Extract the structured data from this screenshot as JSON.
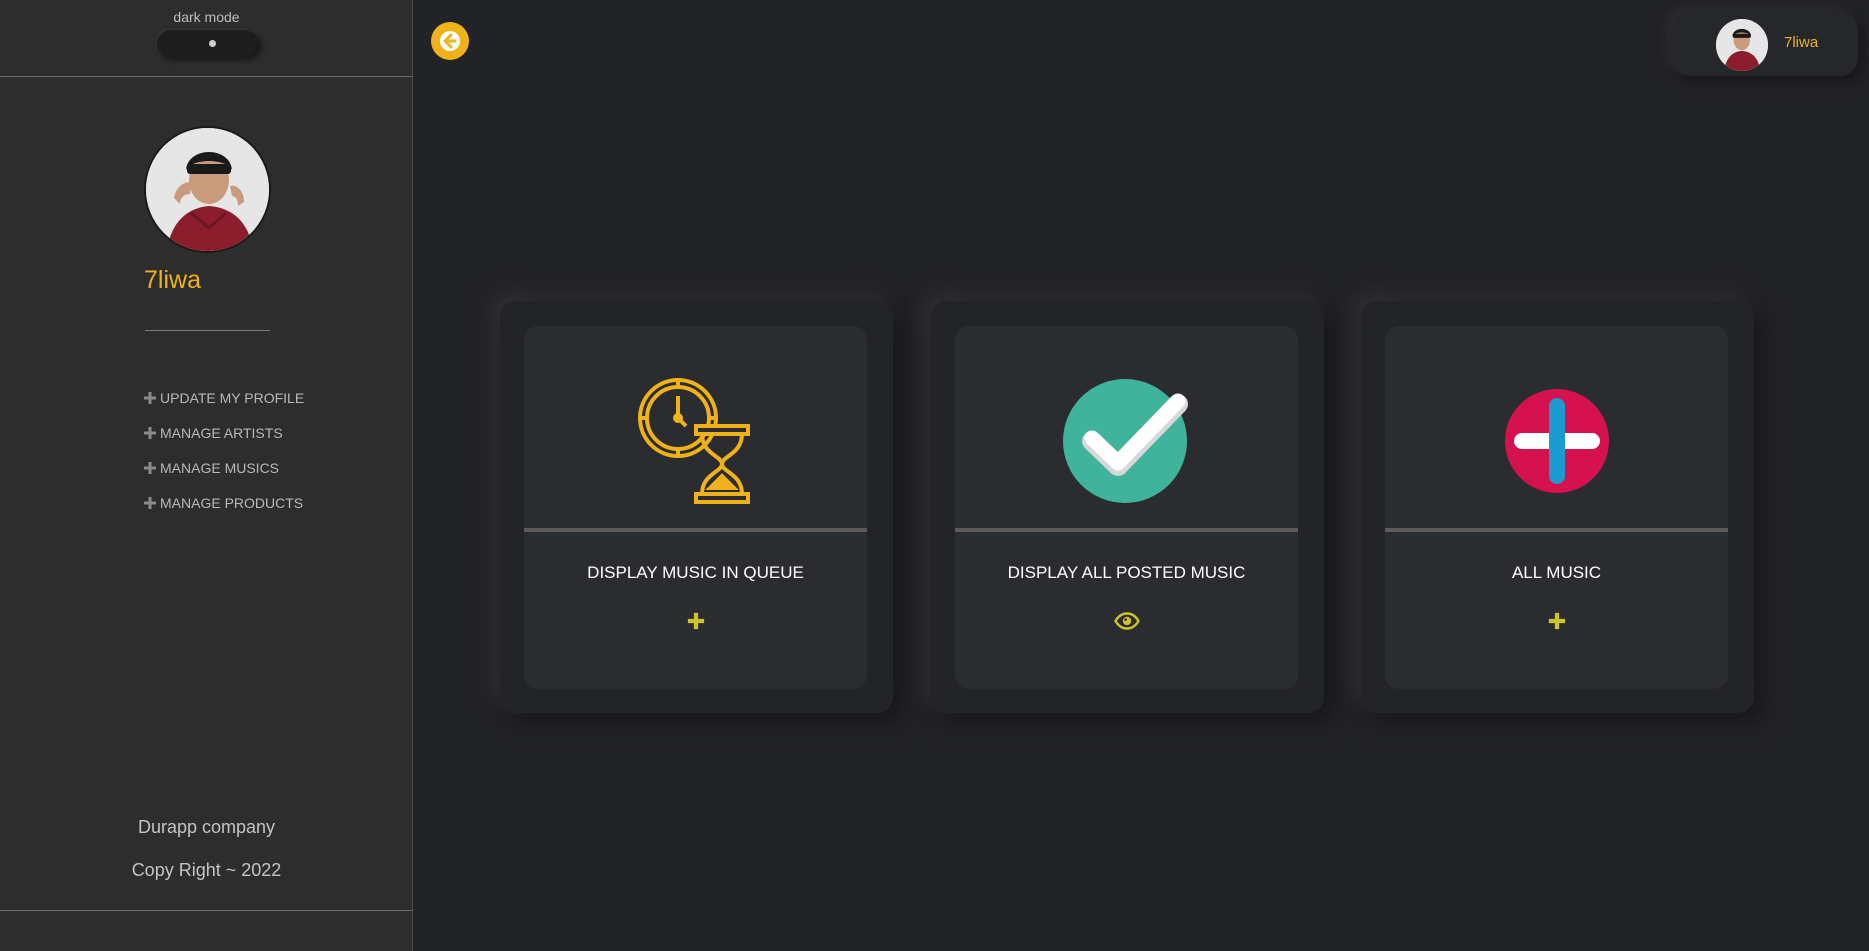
{
  "sidebar": {
    "dark_mode_label": "dark mode",
    "profile_name": "7liwa",
    "menu": [
      {
        "label": "UPDATE MY PROFILE",
        "icon": "plus-icon"
      },
      {
        "label": "MANAGE ARTISTS",
        "icon": "plus-icon"
      },
      {
        "label": "MANAGE MUSICS",
        "icon": "plus-icon"
      },
      {
        "label": "MANAGE PRODUCTS",
        "icon": "plus-icon"
      }
    ],
    "footer": {
      "company": "Durapp company",
      "copyright": "Copy Right ~ 2022"
    }
  },
  "header": {
    "back_icon": "arrow-left-icon",
    "user_name": "7liwa"
  },
  "cards": [
    {
      "title": "DISPLAY MUSIC IN QUEUE",
      "icon": "clock-hourglass-icon",
      "action_icon": "plus-icon"
    },
    {
      "title": "DISPLAY ALL POSTED MUSIC",
      "icon": "checkmark-icon",
      "action_icon": "eye-icon"
    },
    {
      "title": "ALL MUSIC",
      "icon": "add-circle-icon",
      "action_icon": "plus-icon"
    }
  ],
  "colors": {
    "accent": "#f0b21a",
    "background": "#222326",
    "sidebar": "#2d2d2d",
    "check_green": "#3fb39b",
    "add_red": "#d6114f",
    "add_blue": "#1b9bd1",
    "action_yellow": "#c9c52b"
  }
}
